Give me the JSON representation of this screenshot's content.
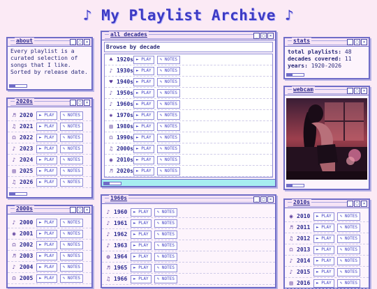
{
  "page": {
    "title": "♪ My Playlist Archive ♪"
  },
  "about": {
    "title": "about",
    "text": "Every playlist is a curated selection of songs that I like. Sorted by release date."
  },
  "w2020s": {
    "title": "2020s",
    "rows": [
      {
        "icon": "♬",
        "year": "2020",
        "play": "► PLAY",
        "notes": "✎ NOTES"
      },
      {
        "icon": "♫",
        "year": "2021",
        "play": "► PLAY",
        "notes": "✎ NOTES"
      },
      {
        "icon": "☊",
        "year": "2022",
        "play": "► PLAY",
        "notes": "✎ NOTES"
      },
      {
        "icon": "♪",
        "year": "2023",
        "play": "► PLAY",
        "notes": "✎ NOTES"
      },
      {
        "icon": "♪",
        "year": "2024",
        "play": "► PLAY",
        "notes": "✎ NOTES"
      },
      {
        "icon": "▥",
        "year": "2025",
        "play": "► PLAY",
        "notes": "✎ NOTES"
      },
      {
        "icon": "♫",
        "year": "2026",
        "play": "► PLAY",
        "notes": "✎ NOTES"
      }
    ]
  },
  "w2000s": {
    "title": "2000s",
    "rows": [
      {
        "icon": "♪",
        "year": "2000",
        "play": "► PLAY",
        "notes": "✎ NOTES"
      },
      {
        "icon": "◉",
        "year": "2001",
        "play": "► PLAY",
        "notes": "✎ NOTES"
      },
      {
        "icon": "☊",
        "year": "2002",
        "play": "► PLAY",
        "notes": "✎ NOTES"
      },
      {
        "icon": "♬",
        "year": "2003",
        "play": "► PLAY",
        "notes": "✎ NOTES"
      },
      {
        "icon": "♪",
        "year": "2004",
        "play": "► PLAY",
        "notes": "✎ NOTES"
      },
      {
        "icon": "☊",
        "year": "2005",
        "play": "► PLAY",
        "notes": "✎ NOTES"
      }
    ]
  },
  "all": {
    "title": "all decades",
    "browse": "Browse by decade",
    "rows": [
      {
        "icon": "♣",
        "dec": "1920s",
        "play": "► PLAY",
        "notes": "✎ NOTES"
      },
      {
        "icon": "♪",
        "dec": "1930s",
        "play": "► PLAY",
        "notes": "✎ NOTES"
      },
      {
        "icon": "♥",
        "dec": "1940s",
        "play": "► PLAY",
        "notes": "✎ NOTES"
      },
      {
        "icon": "♪",
        "dec": "1950s",
        "play": "► PLAY",
        "notes": "✎ NOTES"
      },
      {
        "icon": "♪",
        "dec": "1960s",
        "play": "► PLAY",
        "notes": "✎ NOTES"
      },
      {
        "icon": "✺",
        "dec": "1970s",
        "play": "► PLAY",
        "notes": "✎ NOTES"
      },
      {
        "icon": "▥",
        "dec": "1980s",
        "play": "► PLAY",
        "notes": "✎ NOTES"
      },
      {
        "icon": "☊",
        "dec": "1990s",
        "play": "► PLAY",
        "notes": "✎ NOTES"
      },
      {
        "icon": "♫",
        "dec": "2000s",
        "play": "► PLAY",
        "notes": "✎ NOTES"
      },
      {
        "icon": "◉",
        "dec": "2010s",
        "play": "► PLAY",
        "notes": "✎ NOTES"
      },
      {
        "icon": "♬",
        "dec": "2020s",
        "play": "► PLAY",
        "notes": "✎ NOTES"
      }
    ]
  },
  "w1960s": {
    "title": "1960s",
    "rows": [
      {
        "icon": "♪",
        "year": "1960",
        "play": "► PLAY",
        "notes": "✎ NOTES"
      },
      {
        "icon": "♪",
        "year": "1961",
        "play": "► PLAY",
        "notes": "✎ NOTES"
      },
      {
        "icon": "♪",
        "year": "1962",
        "play": "► PLAY",
        "notes": "✎ NOTES"
      },
      {
        "icon": "♪",
        "year": "1963",
        "play": "► PLAY",
        "notes": "✎ NOTES"
      },
      {
        "icon": "◍",
        "year": "1964",
        "play": "► PLAY",
        "notes": "✎ NOTES"
      },
      {
        "icon": "♬",
        "year": "1965",
        "play": "► PLAY",
        "notes": "✎ NOTES"
      },
      {
        "icon": "♫",
        "year": "1966",
        "play": "► PLAY",
        "notes": "✎ NOTES"
      }
    ]
  },
  "stats": {
    "title": "stats",
    "playlists_label": "total playlists:",
    "playlists": "48",
    "decades_label": "decades covered:",
    "decades": "11",
    "years_label": "years:",
    "years": "1920-2026"
  },
  "webcam": {
    "title": "webcam"
  },
  "w2010s": {
    "title": "2010s",
    "rows": [
      {
        "icon": "◉",
        "year": "2010",
        "play": "► PLAY",
        "notes": "✎ NOTES"
      },
      {
        "icon": "♬",
        "year": "2011",
        "play": "► PLAY",
        "notes": "✎ NOTES"
      },
      {
        "icon": "♫",
        "year": "2012",
        "play": "► PLAY",
        "notes": "✎ NOTES"
      },
      {
        "icon": "☊",
        "year": "2013",
        "play": "► PLAY",
        "notes": "✎ NOTES"
      },
      {
        "icon": "♪",
        "year": "2014",
        "play": "► PLAY",
        "notes": "✎ NOTES"
      },
      {
        "icon": "♪",
        "year": "2015",
        "play": "► PLAY",
        "notes": "✎ NOTES"
      },
      {
        "icon": "▥",
        "year": "2016",
        "play": "► PLAY",
        "notes": "✎ NOTES"
      }
    ]
  },
  "window_buttons": {
    "min": "_",
    "max": "□",
    "close": "×"
  }
}
